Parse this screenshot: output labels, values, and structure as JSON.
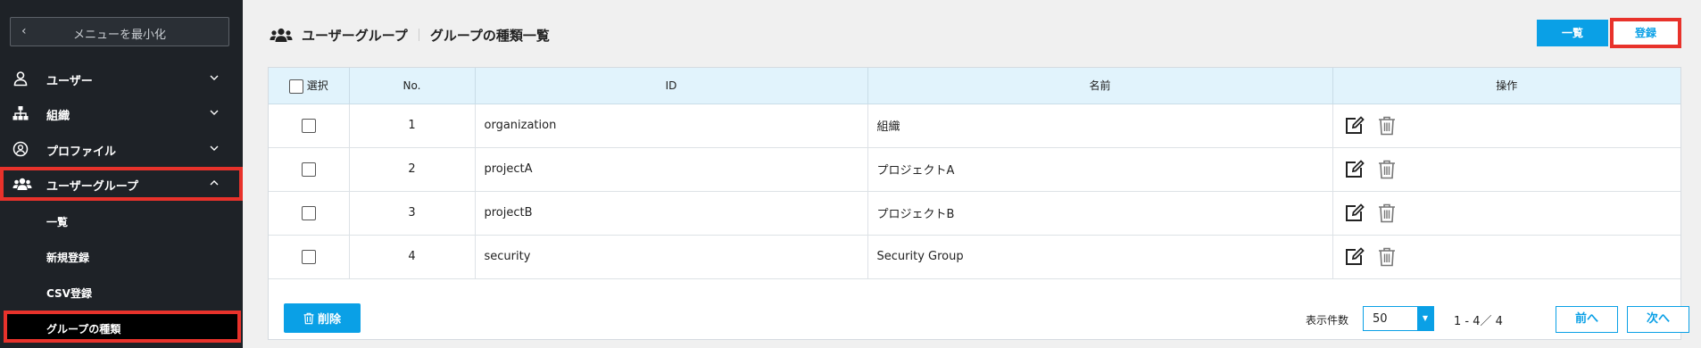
{
  "sidebar": {
    "collapse_label": "メニューを最小化",
    "items": [
      {
        "label": "ユーザー",
        "icon": "user-icon"
      },
      {
        "label": "組織",
        "icon": "org-chart-icon"
      },
      {
        "label": "プロファイル",
        "icon": "profile-icon"
      },
      {
        "label": "ユーザーグループ",
        "icon": "users-icon",
        "expanded": true
      }
    ],
    "sub_items": [
      {
        "label": "一覧"
      },
      {
        "label": "新規登録"
      },
      {
        "label": "CSV登録"
      },
      {
        "label": "グループの種類",
        "active": true
      }
    ]
  },
  "header": {
    "section": "ユーザーグループ",
    "title": "グループの種類一覧",
    "list_button": "一覧",
    "register_button": "登録"
  },
  "table": {
    "columns": [
      "選択",
      "No.",
      "ID",
      "名前",
      "操作"
    ],
    "rows": [
      {
        "no": "1",
        "id": "organization",
        "name": "組織"
      },
      {
        "no": "2",
        "id": "projectA",
        "name": "プロジェクトA"
      },
      {
        "no": "3",
        "id": "projectB",
        "name": "プロジェクトB"
      },
      {
        "no": "4",
        "id": "security",
        "name": "Security Group"
      }
    ]
  },
  "footer": {
    "delete_button": "削除",
    "per_page_label": "表示件数",
    "per_page_value": "50",
    "range": "1 - 4／ 4",
    "prev_button": "前へ",
    "next_button": "次へ"
  },
  "colors": {
    "accent": "#0aa0e6",
    "highlight": "#e8322b",
    "sidebar_bg": "#1e2227",
    "header_bg": "#e1f3fc"
  }
}
